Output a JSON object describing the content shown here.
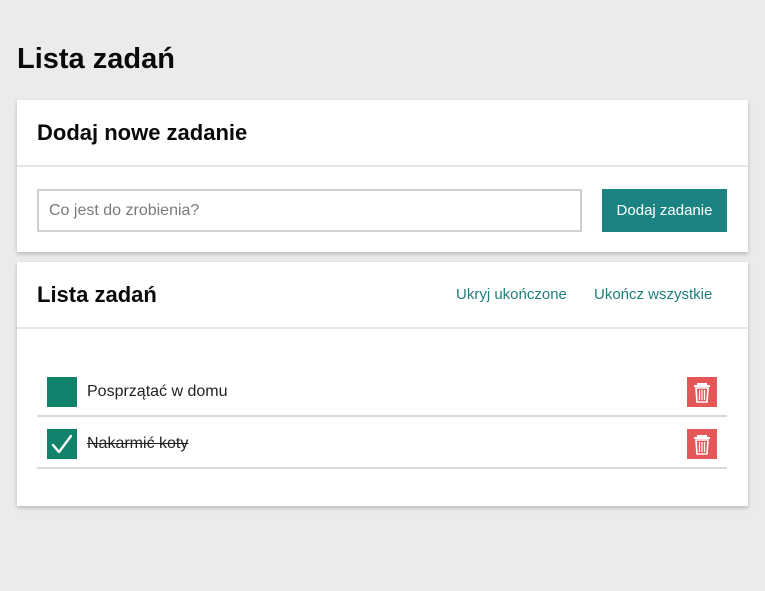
{
  "page": {
    "title": "Lista zadań"
  },
  "add_card": {
    "title": "Dodaj nowe zadanie",
    "input_placeholder": "Co jest do zrobienia?",
    "input_value": "",
    "button_label": "Dodaj zadanie"
  },
  "list_card": {
    "title": "Lista zadań",
    "hide_completed_label": "Ukryj ukończone",
    "complete_all_label": "Ukończ wszystkie",
    "tasks": [
      {
        "label": "Posprzątać w domu",
        "completed": false
      },
      {
        "label": "Nakarmić koty",
        "completed": true
      }
    ]
  },
  "icons": {
    "checkbox": "checkmark-icon",
    "delete": "trash-icon"
  },
  "colors": {
    "background": "#ebebea",
    "accent": "#1b8482",
    "checkbox": "#11826b",
    "delete": "#e55656",
    "link": "#1f7f7d"
  }
}
